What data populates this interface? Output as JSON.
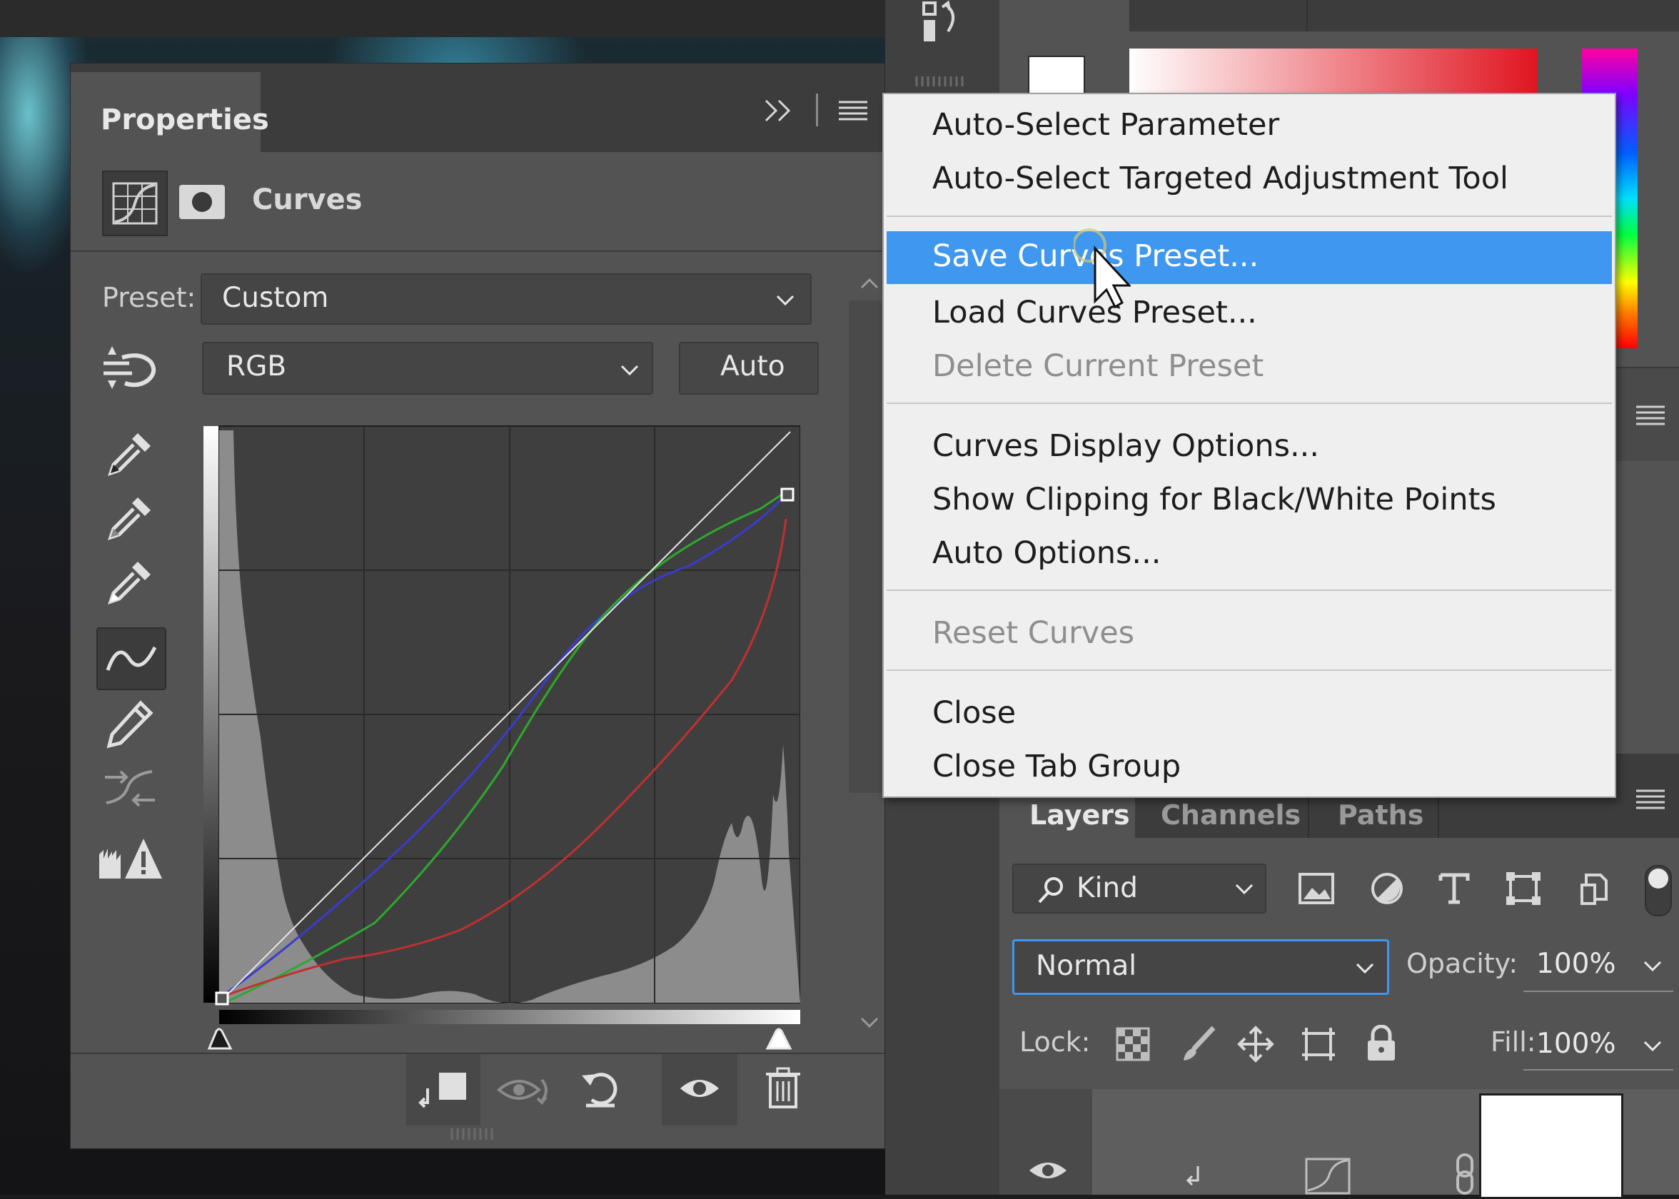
{
  "properties_panel": {
    "tab_title": "Properties",
    "header_title": "Curves",
    "preset_label": "Preset:",
    "preset_value": "Custom",
    "channel_value": "RGB",
    "auto_label": "Auto"
  },
  "context_menu": {
    "items": [
      {
        "label": "Auto-Select Parameter",
        "state": "normal"
      },
      {
        "label": "Auto-Select Targeted Adjustment Tool",
        "state": "normal"
      },
      {
        "label": "Save Curves Preset...",
        "state": "highlighted"
      },
      {
        "label": "Load Curves Preset...",
        "state": "normal"
      },
      {
        "label": "Delete Current Preset",
        "state": "disabled"
      },
      {
        "label": "Curves Display Options...",
        "state": "normal"
      },
      {
        "label": "Show Clipping for Black/White Points",
        "state": "normal"
      },
      {
        "label": "Auto Options...",
        "state": "normal"
      },
      {
        "label": "Reset Curves",
        "state": "disabled"
      },
      {
        "label": "Close",
        "state": "normal"
      },
      {
        "label": "Close Tab Group",
        "state": "normal"
      }
    ],
    "highlight_color": "#3f97ef"
  },
  "layers_panel": {
    "tabs": [
      "Layers",
      "Channels",
      "Paths"
    ],
    "filter_value": "Kind",
    "blend_mode": "Normal",
    "opacity_label": "Opacity:",
    "opacity_value": "100%",
    "lock_label": "Lock:",
    "fill_label": "Fill:",
    "fill_value": "100%"
  },
  "colors": {
    "panel_bg": "#535353",
    "curve_blue": "#3b3bd0",
    "curve_green": "#2ea82e",
    "curve_red": "#c03030",
    "curve_rgb": "#e8e8e8"
  }
}
